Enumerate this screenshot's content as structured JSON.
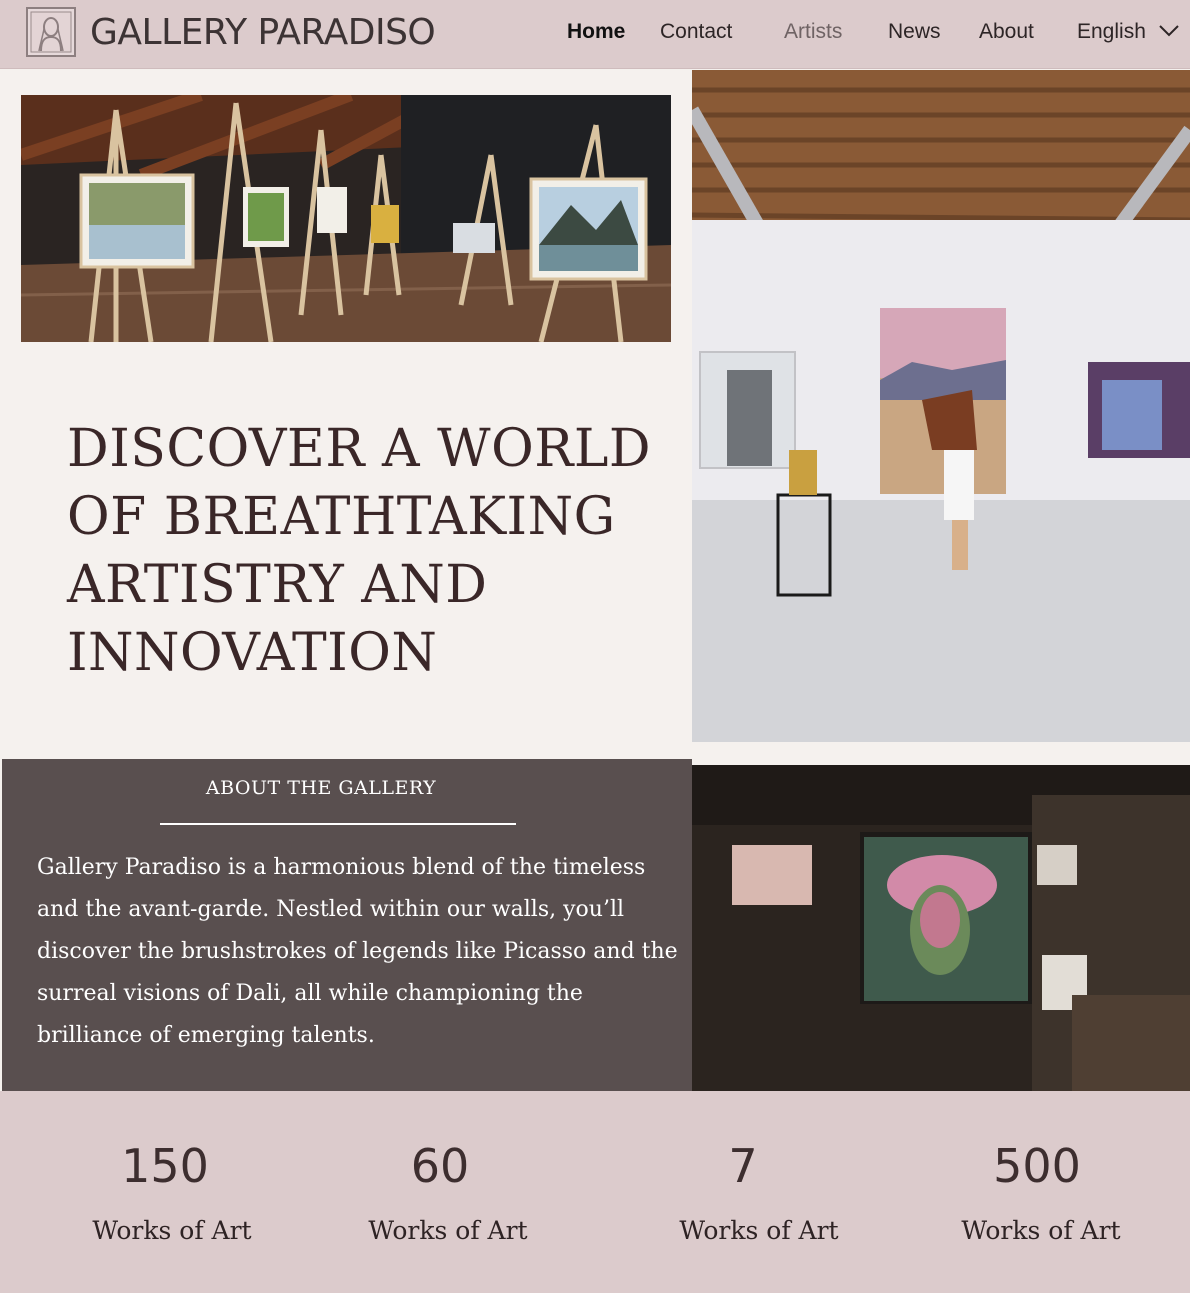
{
  "header": {
    "logo_text": "GALLERY PARADISO",
    "logo_icon": "mona-lisa-portrait-icon",
    "nav": [
      "Home",
      "Contact",
      "Artists",
      "News",
      "About"
    ],
    "language": "English",
    "language_icon": "chevron-down-icon"
  },
  "hero": {
    "title": "DISCOVER A WORLD OF BREATHTAKING ARTISTRY AND INNOVATION",
    "images": [
      "easels-paintings-image",
      "gallery-hall-image",
      "dark-gallery-portrait-image"
    ]
  },
  "about": {
    "title": "ABOUT THE GALLERY",
    "body": " Gallery Paradiso is a harmonious blend of the timeless and the avant-garde. Nestled within our walls, you’ll discover the brushstrokes of legends like Picasso and the surreal visions of Dali, all while championing the brilliance of emerging talents."
  },
  "stats": [
    {
      "value": "150",
      "label": "Works of Art"
    },
    {
      "value": "60",
      "label": "Works of Art"
    },
    {
      "value": "7",
      "label": "Works of Art"
    },
    {
      "value": "500",
      "label": "Works of Art"
    }
  ],
  "colors": {
    "header_bg": "#dccbcc",
    "page_bg": "#f5f1ee",
    "about_bg": "#594f4f",
    "text_dark": "#3a2728"
  }
}
